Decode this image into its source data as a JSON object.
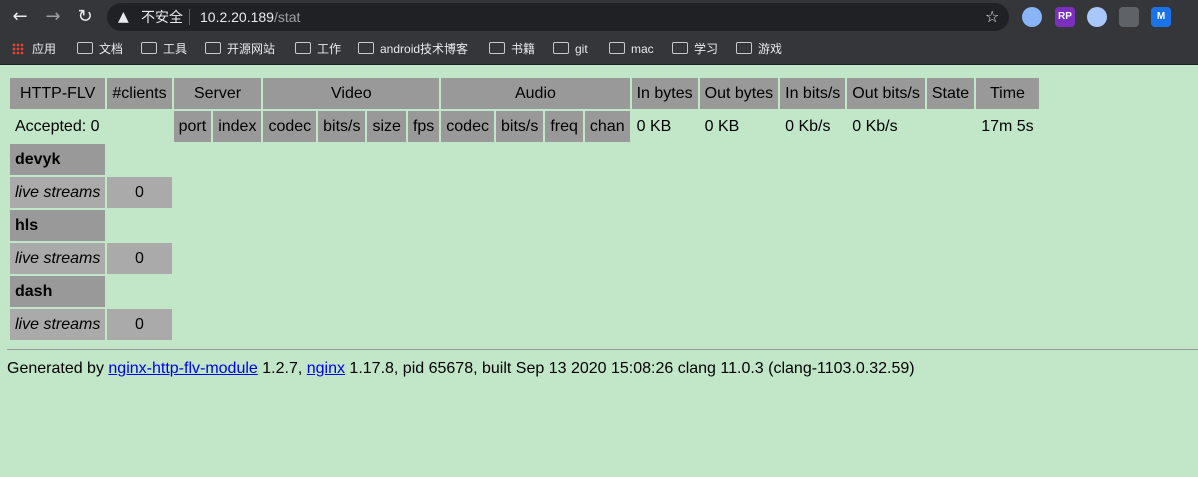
{
  "browser": {
    "nav_back": "←",
    "nav_forward": "→",
    "nav_reload": "↻",
    "warning_icon": "▲",
    "insecure_label": "不安全",
    "url_host": "10.2.20.189",
    "url_path": "/stat",
    "star": "☆",
    "extensions": [
      {
        "name": "ext-blue-circle-icon",
        "label": "",
        "color": "#8ab4f8"
      },
      {
        "name": "ext-rp-icon",
        "label": "RP",
        "color": "#7b2fbf"
      },
      {
        "name": "ext-cyan-circle-icon",
        "label": "",
        "color": "#a8c7fa"
      },
      {
        "name": "ext-shield-icon",
        "label": "",
        "color": "#bdc1c6"
      },
      {
        "name": "ext-m-icon",
        "label": "M",
        "color": "#1a73e8"
      }
    ]
  },
  "bookmarks": {
    "apps": "应用",
    "items": [
      "文档",
      "工具",
      "开源网站",
      "工作",
      "android技术博客",
      "书籍",
      "git",
      "mac",
      "学习",
      "游戏"
    ]
  },
  "stat": {
    "headers": {
      "http_flv": "HTTP-FLV",
      "clients": "#clients",
      "server": "Server",
      "video": "Video",
      "audio": "Audio",
      "in_bytes": "In bytes",
      "out_bytes": "Out bytes",
      "in_bits": "In bits/s",
      "out_bits": "Out bits/s",
      "state": "State",
      "time": "Time"
    },
    "accepted": "Accepted: 0",
    "subheaders": {
      "port": "port",
      "index": "index",
      "vcodec": "codec",
      "vbits": "bits/s",
      "size": "size",
      "fps": "fps",
      "acodec": "codec",
      "abits": "bits/s",
      "freq": "freq",
      "chan": "chan"
    },
    "totals": {
      "in_bytes": "0 KB",
      "out_bytes": "0 KB",
      "in_bits": "0 Kb/s",
      "out_bits": "0 Kb/s",
      "time": "17m 5s"
    },
    "apps": [
      {
        "name": "devyk",
        "live_label": "live streams",
        "live_count": "0"
      },
      {
        "name": "hls",
        "live_label": "live streams",
        "live_count": "0"
      },
      {
        "name": "dash",
        "live_label": "live streams",
        "live_count": "0"
      }
    ]
  },
  "footer": {
    "prefix": "Generated by ",
    "module_link": "nginx-http-flv-module",
    "version": " 1.2.7, ",
    "nginx_link": "nginx",
    "rest": " 1.17.8, pid 65678, built Sep 13 2020 15:08:26 clang 11.0.3 (clang-1103.0.32.59)"
  }
}
